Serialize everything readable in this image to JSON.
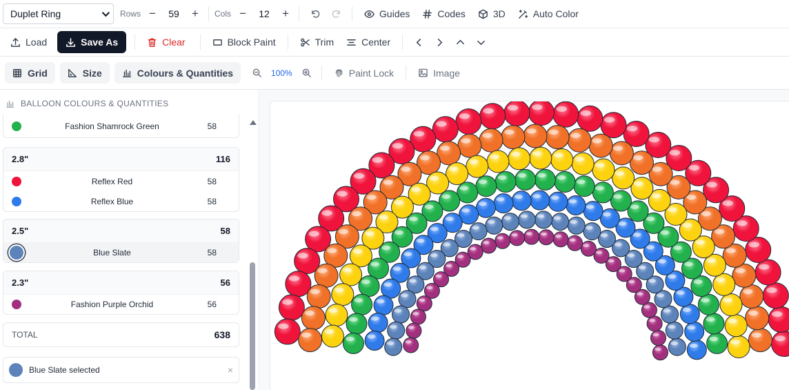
{
  "toolbar1": {
    "design_select": "Duplet Ring",
    "rows_label": "Rows",
    "rows_value": "59",
    "cols_label": "Cols",
    "cols_value": "12",
    "minus": "−",
    "plus": "+",
    "guides": "Guides",
    "codes": "Codes",
    "three_d": "3D",
    "auto_color": "Auto Color"
  },
  "toolbar2": {
    "load": "Load",
    "save_as": "Save As",
    "clear": "Clear",
    "block_paint": "Block Paint",
    "trim": "Trim",
    "center": "Center"
  },
  "toolbar3": {
    "grid": "Grid",
    "size": "Size",
    "colours": "Colours & Quantities",
    "zoom": "100%",
    "paint_lock": "Paint Lock",
    "image": "Image"
  },
  "sidebar": {
    "header": "BALLOON COLOURS & QUANTITIES",
    "partial_item": {
      "name": "Fashion Shamrock Green",
      "qty": "58",
      "color": "#22b14c"
    },
    "groups": [
      {
        "size": "2.8\"",
        "total": "116",
        "items": [
          {
            "name": "Reflex Red",
            "qty": "58",
            "color": "#f0143c"
          },
          {
            "name": "Reflex Blue",
            "qty": "58",
            "color": "#2f7bea"
          }
        ]
      },
      {
        "size": "2.5\"",
        "total": "58",
        "items": [
          {
            "name": "Blue Slate",
            "qty": "58",
            "color": "#5c83ba"
          }
        ]
      },
      {
        "size": "2.3\"",
        "total": "56",
        "items": [
          {
            "name": "Fashion Purple Orchid",
            "qty": "56",
            "color": "#a3307e"
          }
        ]
      }
    ],
    "total_label": "TOTAL",
    "total_value": "638",
    "selected_text": "Blue Slate selected",
    "close": "×"
  },
  "design": {
    "bands": [
      {
        "color": "#f0143c",
        "highlight": "#ff7e96"
      },
      {
        "color": "#f07127",
        "highlight": "#ffb183"
      },
      {
        "color": "#fdd20f",
        "highlight": "#fff08a"
      },
      {
        "color": "#22b14c",
        "highlight": "#7fe39a"
      },
      {
        "color": "#2f7bea",
        "highlight": "#8fbaff"
      },
      {
        "color": "#5c83ba",
        "highlight": "#a9c2e6"
      },
      {
        "color": "#a3307e",
        "highlight": "#d980bd"
      }
    ]
  }
}
